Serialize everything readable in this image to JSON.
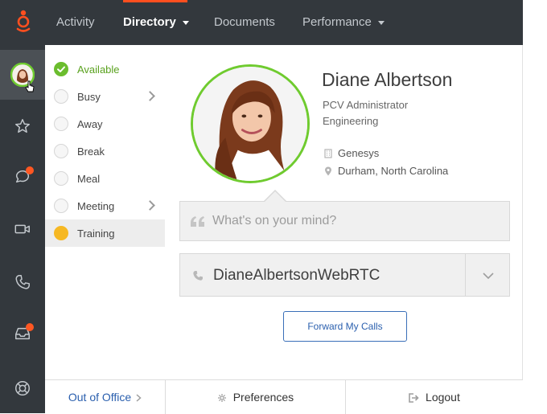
{
  "topnav": {
    "items": [
      {
        "label": "Activity"
      },
      {
        "label": "Directory"
      },
      {
        "label": "Documents"
      },
      {
        "label": "Performance"
      }
    ]
  },
  "colors": {
    "accent": "#ff4f1f",
    "available": "#6bbd2e",
    "training": "#f6b823",
    "link": "#2a5fae"
  },
  "siderail": {
    "items": [
      {
        "icon": "user-avatar-icon"
      },
      {
        "icon": "star-icon"
      },
      {
        "icon": "chat-icon",
        "badge": true
      },
      {
        "icon": "video-icon"
      },
      {
        "icon": "phone-icon"
      },
      {
        "icon": "inbox-icon",
        "badge": true
      },
      {
        "icon": "support-icon"
      }
    ]
  },
  "statuses": [
    {
      "label": "Available",
      "state": "checked"
    },
    {
      "label": "Busy",
      "submenu": true
    },
    {
      "label": "Away"
    },
    {
      "label": "Break"
    },
    {
      "label": "Meal"
    },
    {
      "label": "Meeting",
      "submenu": true
    },
    {
      "label": "Training",
      "state": "selected"
    }
  ],
  "profile": {
    "name": "Diane Albertson",
    "title": "PCV Administrator",
    "department": "Engineering",
    "company": "Genesys",
    "location": "Durham, North Carolina"
  },
  "mind": {
    "placeholder": "What's on your mind?"
  },
  "phone": {
    "station": "DianeAlbertsonWebRTC"
  },
  "forward_button": "Forward My Calls",
  "footer": {
    "out_of_office": "Out of Office",
    "preferences": "Preferences",
    "logout": "Logout"
  }
}
